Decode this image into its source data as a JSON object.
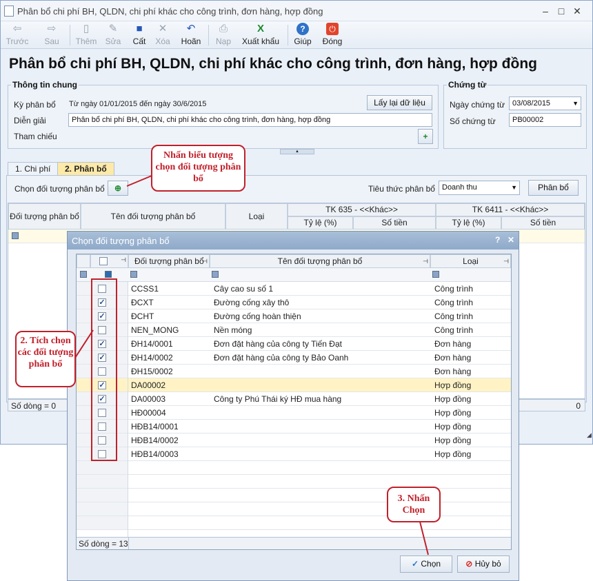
{
  "window": {
    "title": "Phân bổ chi phí BH, QLDN, chi phí khác cho công trình, đơn hàng, hợp đồng",
    "controls": [
      "–",
      "□",
      "✕"
    ]
  },
  "toolbar": {
    "back": "Trước",
    "forward": "Sau",
    "add": "Thêm",
    "edit": "Sửa",
    "save": "Cất",
    "delete": "Xóa",
    "undo": "Hoãn",
    "import": "Nạp",
    "export": "Xuất khẩu",
    "help": "Giúp",
    "close": "Đóng"
  },
  "page_title": "Phân bổ chi phí BH, QLDN, chi phí khác cho công trình, đơn hàng, hợp đồng",
  "general_info": {
    "title": "Thông tin chung",
    "period_label": "Kỳ phân bổ",
    "period_value": "Từ ngày 01/01/2015 đến ngày 30/6/2015",
    "reload_button": "Lấy lại dữ liệu",
    "desc_label": "Diễn giải",
    "desc_value": "Phân bổ chi phí BH, QLDN, chi phí khác cho công trình, đơn hàng, hợp đồng",
    "ref_label": "Tham chiếu"
  },
  "voucher": {
    "title": "Chứng từ",
    "date_label": "Ngày chứng từ",
    "date_value": "03/08/2015",
    "number_label": "Số chứng từ",
    "number_value": "PB00002"
  },
  "tabs": [
    "1. Chi phí",
    "2. Phân bổ"
  ],
  "allocation": {
    "object_label": "Chọn đối tượng phân bổ",
    "criteria_label": "Tiêu thức phân bổ",
    "criteria_value": "Doanh thu",
    "allocate_button": "Phân bổ"
  },
  "main_grid": {
    "col_object": "Đối tượng phân bổ",
    "col_name": "Tên đối tượng phân bổ",
    "col_type": "Loại",
    "group1": "TK 635 - <<Khác>>",
    "group2": "TK 6411 - <<Khác>>",
    "rate": "Tỷ lệ (%)",
    "amount": "Số tiền",
    "footer_rows": "Số dòng = 0",
    "footer_total": "0"
  },
  "callouts": {
    "c1": "Nhấn biểu tượng chọn đối tượng phân bổ",
    "c2": "2. Tích chọn các đối tượng phân bổ",
    "c3": "3. Nhấn Chọn"
  },
  "dialog": {
    "title": "Chọn đối tượng phân bổ",
    "help": "?",
    "close": "✕",
    "col_object": "Đối tượng phân bổ",
    "col_name": "Tên đối tượng phân bổ",
    "col_type": "Loại",
    "rows": [
      {
        "code": "CCSS1",
        "name": "Cây cao su số 1",
        "type": "Công trình",
        "checked": false
      },
      {
        "code": "ĐCXT",
        "name": "Đường cống xây thô",
        "type": "Công trình",
        "checked": true
      },
      {
        "code": "ĐCHT",
        "name": "Đường cống hoàn thiện",
        "type": "Công trình",
        "checked": true
      },
      {
        "code": "NEN_MONG",
        "name": "Nền móng",
        "type": "Công trình",
        "checked": false
      },
      {
        "code": "ĐH14/0001",
        "name": "Đơn đặt hàng của công ty Tiến Đạt",
        "type": "Đơn hàng",
        "checked": true
      },
      {
        "code": "ĐH14/0002",
        "name": "Đơn đặt hàng của công ty Bảo Oanh",
        "type": "Đơn hàng",
        "checked": true
      },
      {
        "code": "ĐH15/0002",
        "name": "",
        "type": "Đơn hàng",
        "checked": false
      },
      {
        "code": "DA00002",
        "name": "",
        "type": "Hợp đồng",
        "checked": true
      },
      {
        "code": "DA00003",
        "name": "Công ty Phú Thái ký HĐ mua hàng",
        "type": "Hợp đồng",
        "checked": true
      },
      {
        "code": "HĐ00004",
        "name": "",
        "type": "Hợp đồng",
        "checked": false
      },
      {
        "code": "HĐB14/0001",
        "name": "",
        "type": "Hợp đồng",
        "checked": false
      },
      {
        "code": "HĐB14/0002",
        "name": "",
        "type": "Hợp đồng",
        "checked": false
      },
      {
        "code": "HĐB14/0003",
        "name": "",
        "type": "Hợp đồng",
        "checked": false
      }
    ],
    "footer": "Số dòng = 13",
    "choose_button": "Chọn",
    "cancel_button": "Hủy bỏ"
  }
}
